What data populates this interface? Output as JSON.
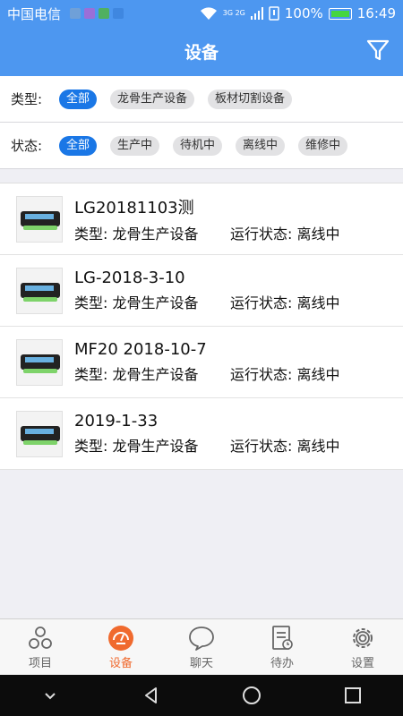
{
  "status_bar": {
    "carrier": "中国电信",
    "network": "3G 2G",
    "battery": "100%",
    "time": "16:49"
  },
  "header": {
    "title": "设备",
    "filter_icon": "filter-icon"
  },
  "filters": {
    "type_label": "类型:",
    "type_options": [
      "全部",
      "龙骨生产设备",
      "板材切割设备"
    ],
    "status_label": "状态:",
    "status_options": [
      "全部",
      "生产中",
      "待机中",
      "离线中",
      "维修中"
    ]
  },
  "devices": [
    {
      "name": "LG20181103测",
      "type": "类型: 龙骨生产设备",
      "status": "运行状态: 离线中"
    },
    {
      "name": "LG-2018-3-10",
      "type": "类型: 龙骨生产设备",
      "status": "运行状态: 离线中"
    },
    {
      "name": "MF20 2018-10-7",
      "type": "类型: 龙骨生产设备",
      "status": "运行状态: 离线中"
    },
    {
      "name": "2019-1-33",
      "type": "类型: 龙骨生产设备",
      "status": "运行状态: 离线中"
    }
  ],
  "tabbar": {
    "items": [
      {
        "label": "项目",
        "icon": "project-icon"
      },
      {
        "label": "设备",
        "icon": "device-icon",
        "active": true
      },
      {
        "label": "聊天",
        "icon": "chat-icon"
      },
      {
        "label": "待办",
        "icon": "todo-icon"
      },
      {
        "label": "设置",
        "icon": "settings-icon"
      }
    ]
  },
  "colors": {
    "header": "#4d97f0",
    "chip_active": "#1a77e6",
    "tab_active": "#f06a2e"
  }
}
